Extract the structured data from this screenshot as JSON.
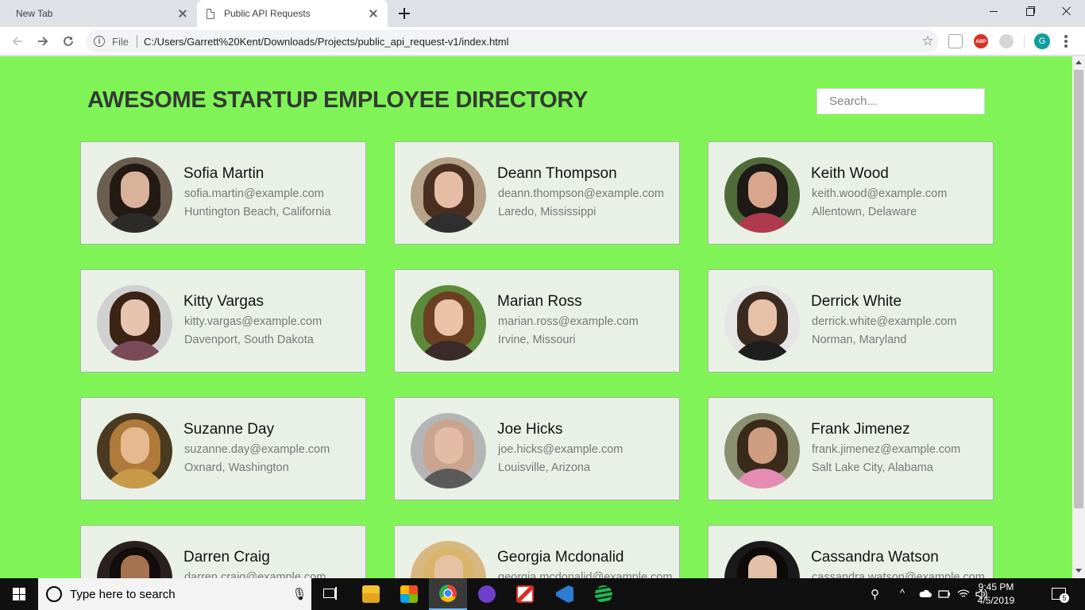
{
  "browser": {
    "tabs": [
      {
        "title": "New Tab",
        "active": false
      },
      {
        "title": "Public API Requests",
        "active": true
      }
    ],
    "address": {
      "scheme": "File",
      "url": "C:/Users/Garrett%20Kent/Downloads/Projects/public_api_request-v1/index.html"
    },
    "extensions": [
      "pocket-icon",
      "adblock-plus-icon",
      "extension-icon"
    ],
    "adblock_label": "ABP",
    "profile_initial": "G"
  },
  "page": {
    "background_color": "#80f457",
    "title": "AWESOME STARTUP EMPLOYEE DIRECTORY",
    "search_placeholder": "Search...",
    "employees": [
      {
        "name": "Sofia Martin",
        "email": "sofia.martin@example.com",
        "location": "Huntington Beach, California"
      },
      {
        "name": "Deann Thompson",
        "email": "deann.thompson@example.com",
        "location": "Laredo, Mississippi"
      },
      {
        "name": "Keith Wood",
        "email": "keith.wood@example.com",
        "location": "Allentown, Delaware"
      },
      {
        "name": "Kitty Vargas",
        "email": "kitty.vargas@example.com",
        "location": "Davenport, South Dakota"
      },
      {
        "name": "Marian Ross",
        "email": "marian.ross@example.com",
        "location": "Irvine, Missouri"
      },
      {
        "name": "Derrick White",
        "email": "derrick.white@example.com",
        "location": "Norman, Maryland"
      },
      {
        "name": "Suzanne Day",
        "email": "suzanne.day@example.com",
        "location": "Oxnard, Washington"
      },
      {
        "name": "Joe Hicks",
        "email": "joe.hicks@example.com",
        "location": "Louisville, Arizona"
      },
      {
        "name": "Frank Jimenez",
        "email": "frank.jimenez@example.com",
        "location": "Salt Lake City, Alabama"
      },
      {
        "name": "Darren Craig",
        "email": "darren.craig@example.com",
        "location": ""
      },
      {
        "name": "Georgia Mcdonalid",
        "email": "georgia.mcdonalid@example.com",
        "location": ""
      },
      {
        "name": "Cassandra Watson",
        "email": "cassandra.watson@example.com",
        "location": ""
      }
    ]
  },
  "taskbar": {
    "search_placeholder": "Type here to search",
    "apps": [
      "file-explorer-icon",
      "store-icon",
      "chrome-icon",
      "github-desktop-icon",
      "gmail-icon",
      "vscode-icon",
      "spotify-icon"
    ],
    "time": "9:45 PM",
    "date": "4/5/2019",
    "notification_count": "5"
  }
}
